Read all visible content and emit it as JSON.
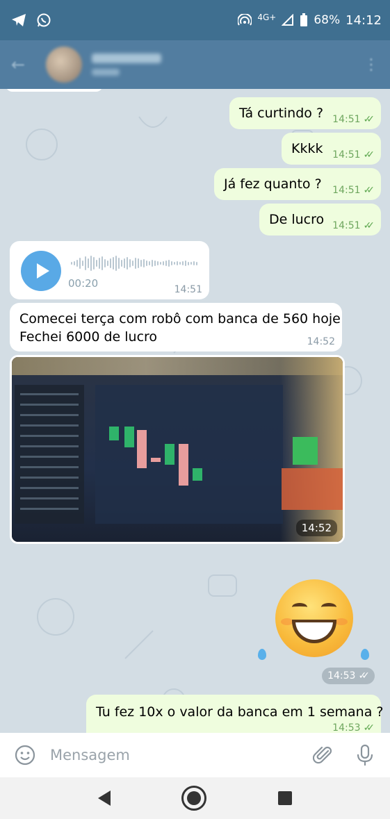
{
  "status_bar": {
    "network": "4G+",
    "battery": "68%",
    "time": "14:12"
  },
  "messages": [
    {
      "text": "Tá curtindo ?",
      "time": "14:51"
    },
    {
      "text": "Kkkk",
      "time": "14:51"
    },
    {
      "text": "Já fez quanto ?",
      "time": "14:51"
    },
    {
      "text": "De lucro",
      "time": "14:51"
    }
  ],
  "voice_message": {
    "duration": "00:20",
    "time": "14:51"
  },
  "incoming_text": {
    "line1": "Comecei terça com robô com banca de 560 hoje",
    "line2": "Fechei 6000 de lucro",
    "time": "14:52"
  },
  "photo": {
    "time": "14:52"
  },
  "emoji_message": {
    "time": "14:53"
  },
  "last_message": {
    "text": "Tu fez 10x o valor da banca em 1 semana ?",
    "time": "14:53"
  },
  "input": {
    "placeholder": "Mensagem"
  },
  "colors": {
    "outgoing_bubble": "#effdde",
    "incoming_bubble": "#ffffff",
    "header": "#527da0",
    "check": "#5fa851",
    "play_button": "#59a9e6"
  }
}
